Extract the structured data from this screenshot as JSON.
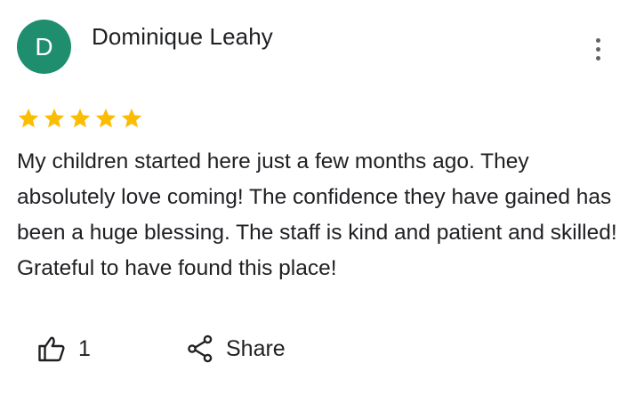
{
  "review": {
    "avatar_letter": "D",
    "avatar_color": "#1e8e6e",
    "author": "Dominique Leahy",
    "rating": 5,
    "rating_max": 5,
    "star_color": "#fbbc04",
    "text": "My children started here just a few months ago. They absolutely love coming! The confidence they have gained has been a huge blessing. The staff is kind and patient and skilled! Grateful to have found this place!",
    "like_count": "1",
    "share_label": "Share"
  },
  "icons": {
    "more": "more-vert-icon",
    "like": "thumb-up-icon",
    "share": "share-icon",
    "star": "star-icon"
  }
}
